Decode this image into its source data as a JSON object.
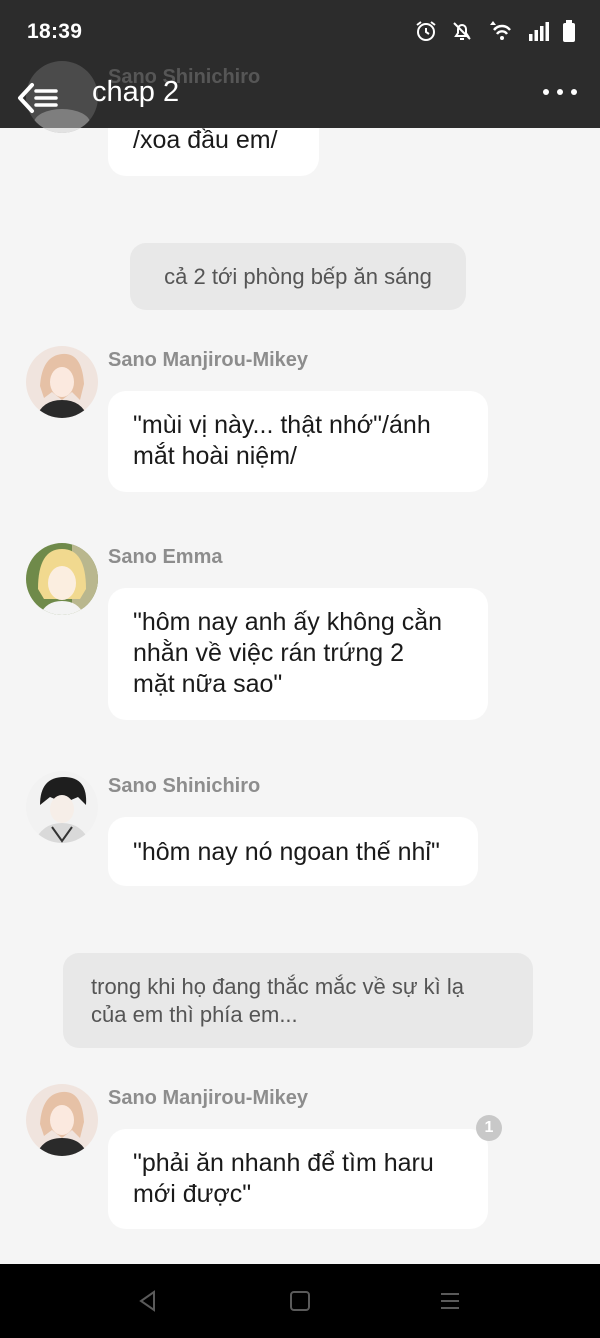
{
  "status_bar": {
    "time": "18:39"
  },
  "app_bar": {
    "title": "chap 2"
  },
  "messages": [
    {
      "sender": "Sano Shinichiro",
      "text": "/xoa đầu em/"
    },
    {
      "narration": "cả 2 tới phòng bếp ăn sáng"
    },
    {
      "sender": "Sano Manjirou-Mikey",
      "lines": [
        "\"mùi vị này... thật nhớ\"/ánh",
        "mắt hoài niệm/"
      ]
    },
    {
      "sender": "Sano Emma",
      "lines": [
        "\"hôm nay anh ấy không cằn",
        "nhằn về việc rán trứng 2",
        "mặt nữa sao\""
      ]
    },
    {
      "sender": "Sano Shinichiro",
      "text": "\"hôm nay nó ngoan thế nhỉ\""
    },
    {
      "narration_lines": [
        "trong khi họ đang thắc mắc về sự kì lạ",
        "của em thì phía em..."
      ]
    },
    {
      "sender": "Sano Manjirou-Mikey",
      "lines": [
        "\"phải ăn nhanh để tìm haru",
        "mới được\""
      ],
      "badge": "1"
    }
  ],
  "colors": {
    "topbar": "#2c2c2c",
    "background": "#f5f5f5",
    "bubble": "#ffffff",
    "narration": "#e8e8e8",
    "sender_name": "#8d8d8d"
  },
  "icons": [
    "alarm-icon",
    "bell-off-icon",
    "wifi-icon",
    "signal-icon",
    "battery-icon",
    "back-list-icon",
    "more-icon",
    "nav-back-icon",
    "nav-home-icon",
    "nav-menu-icon"
  ]
}
